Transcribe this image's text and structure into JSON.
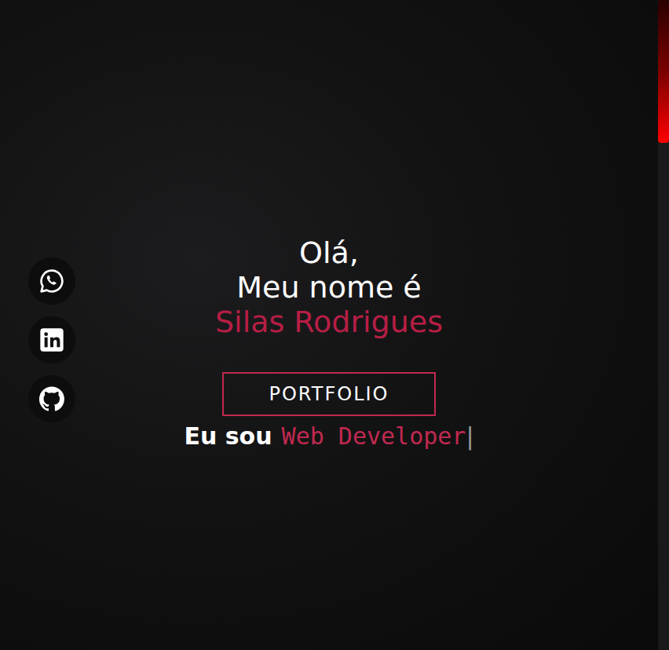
{
  "hero": {
    "greeting": "Olá,",
    "intro": "Meu nome é",
    "name": "Silas Rodrigues",
    "button": "PORTFOLIO",
    "typed_prefix": "Eu sou",
    "typed_text": "Web Developer",
    "cursor": "|"
  },
  "socials": [
    {
      "kind": "whatsapp"
    },
    {
      "kind": "linkedin"
    },
    {
      "kind": "github"
    }
  ],
  "scrollbar": {
    "level": 0.22
  }
}
